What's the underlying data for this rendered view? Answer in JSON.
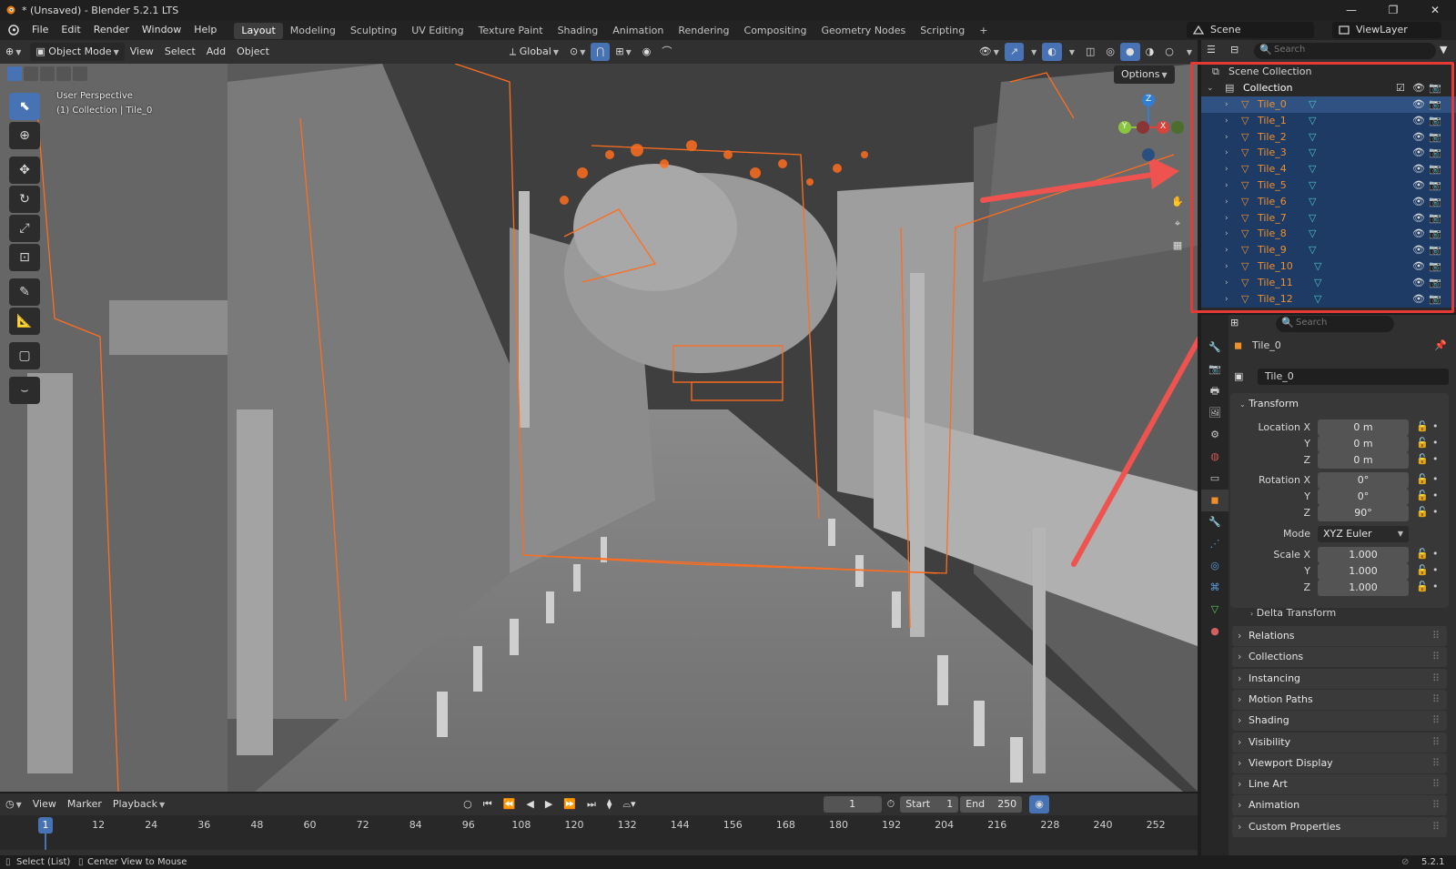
{
  "window": {
    "title": "* (Unsaved) - Blender 5.2.1 LTS",
    "controls": [
      "—",
      "❐",
      "✕"
    ]
  },
  "menubar": {
    "menus": [
      "File",
      "Edit",
      "Render",
      "Window",
      "Help"
    ],
    "workspaces": [
      "Layout",
      "Modeling",
      "Sculpting",
      "UV Editing",
      "Texture Paint",
      "Shading",
      "Animation",
      "Rendering",
      "Compositing",
      "Geometry Nodes",
      "Scripting"
    ],
    "active_workspace": "Layout",
    "add_workspace": "+",
    "scene": "Scene",
    "view_layer": "ViewLayer"
  },
  "viewport_header": {
    "mode": "Object Mode",
    "menus": [
      "View",
      "Select",
      "Add",
      "Object"
    ],
    "transform_orientation": "Global",
    "options_label": "Options"
  },
  "viewport": {
    "perspective": "User Perspective",
    "context": "(1) Collection | Tile_0",
    "gizmo_axes": [
      "Z",
      "Y",
      "X"
    ]
  },
  "outliner": {
    "search_placeholder": "Search",
    "scene_collection": "Scene Collection",
    "collection": "Collection",
    "items": [
      "Tile_0",
      "Tile_1",
      "Tile_2",
      "Tile_3",
      "Tile_4",
      "Tile_5",
      "Tile_6",
      "Tile_7",
      "Tile_8",
      "Tile_9",
      "Tile_10",
      "Tile_11",
      "Tile_12"
    ],
    "active_item": "Tile_0"
  },
  "properties": {
    "search_placeholder": "Search",
    "object_name": "Tile_0",
    "datablock_name": "Tile_0",
    "transform": {
      "title": "Transform",
      "location_label": "Location X",
      "rotation_label": "Rotation X",
      "scale_label": "Scale X",
      "mode_label": "Mode",
      "y_label": "Y",
      "z_label": "Z",
      "location": [
        "0 m",
        "0 m",
        "0 m"
      ],
      "rotation": [
        "0°",
        "0°",
        "90°"
      ],
      "mode": "XYZ Euler",
      "scale": [
        "1.000",
        "1.000",
        "1.000"
      ],
      "delta": "Delta Transform"
    },
    "panels": [
      "Relations",
      "Collections",
      "Instancing",
      "Motion Paths",
      "Shading",
      "Visibility",
      "Viewport Display",
      "Line Art",
      "Animation",
      "Custom Properties"
    ]
  },
  "timeline": {
    "menus": [
      "View",
      "Marker",
      "Playback"
    ],
    "current_frame": "1",
    "start_label": "Start",
    "start": "1",
    "end_label": "End",
    "end": "250",
    "ruler": [
      "1",
      "12",
      "24",
      "36",
      "48",
      "60",
      "72",
      "84",
      "96",
      "108",
      "120",
      "132",
      "144",
      "156",
      "168",
      "180",
      "192",
      "204",
      "216",
      "228",
      "240",
      "252"
    ]
  },
  "statusbar": {
    "left": "Select (List)",
    "middle": "Center View to Mouse",
    "version": "5.2.1"
  },
  "colors": {
    "highlight_box": "#e53935",
    "arrow": "#ef5350",
    "selection_outline": "#ff6d1f",
    "active_tool": "#4772b3",
    "outliner_selected": "#1e3b66"
  }
}
